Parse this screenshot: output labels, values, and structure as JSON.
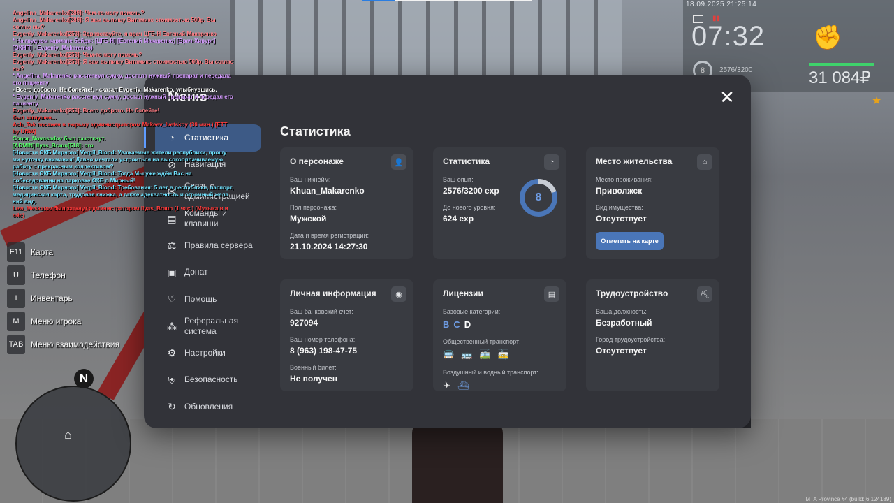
{
  "chat": [
    {
      "text": "Angelina_Makarenko[289]: Чем-то могу помочь?",
      "color": "#ff7b82"
    },
    {
      "text": "Angelina_Makarenko[289]: Я вам выпишу Витамикс стоимостью 500р. Вы соглас ны?",
      "color": "#ff7b82"
    },
    {
      "text": "Evgeniy_Makarenko[253]: Здравствуйте, я врач ЦГБ-Н Евгений Макаренко",
      "color": "#ff7b82"
    },
    {
      "text": "* На грудном кармане бейдж: [ЦГБ-Н] [Евгений Макаренко] [Врач-Хирург] [ОКНП] - Evgeniy_Makarenko)",
      "color": "#d59bff"
    },
    {
      "text": "Evgeniy_Makarenko[253]: Чем-то могу помочь?",
      "color": "#ff7b82"
    },
    {
      "text": "Evgeniy_Makarenko[253]: Я вам выпишу Витамикс стоимостью 500р. Вы соглас ны?",
      "color": "#ff7b82"
    },
    {
      "text": "* Angelina_Makarenko расстегнул сумку, достала нужный препарат и передала его пациенту",
      "color": "#d59bff"
    },
    {
      "text": "- Всего доброго. Не болейте!, - сказал Evgeniy_Makarenko, улыбнувшись.",
      "color": "#ffffff"
    },
    {
      "text": "* Evgeniy_Makarenko расстегнул сумку, достал нужный препарат и передал его пациенту",
      "color": "#d59bff"
    },
    {
      "text": "Evgeniy_Makarenko[253]: Всего доброго. Не болейте!",
      "color": "#ff7b82"
    },
    {
      "text": "был заглушен...",
      "color": "#ff3b3b"
    },
    {
      "text": "Ach_Tok посажен в тюрьму администратором Makeev_Ivetskoy (30 мин.) [ETT by UNW]",
      "color": "#ff3b3b"
    },
    {
      "text": "Conor_Novosadov был разоткнут.",
      "color": "#56ff6a"
    },
    {
      "text": "[ADMIN] Ilyas_Braun[518]: ого",
      "color": "#56ff6a"
    },
    {
      "text": "[Новости ОКБ Мирного] Vergil_Blood: Уважаемые жители республики, прошу ми нуточку внимания! Давно мечтали устроиться на высокооплачиваемую работу с прекрасным коллективом?",
      "color": "#6fe3ff"
    },
    {
      "text": "[Новости ОКБ Мирного] Vergil_Blood: Тогда Мы уже ждём Вас на собеседовании на парковке ОКБ г. Мирный!",
      "color": "#6fe3ff"
    },
    {
      "text": "[Новости ОКБ Мирного] Vergil_Blood: Требования: 5 лет в республике, паспорт, медицинская карта, трудовая книжка, а также адекватность и огромный жела ний вид.",
      "color": "#6fe3ff"
    },
    {
      "text": "Lew_Meskatov был заткнут администратором Ilyas_Braun (1 час.) (Музыка в и ойс)",
      "color": "#ff3b3b"
    }
  ],
  "hud": {
    "datetime": "18.09.2025 21:25:14",
    "time": "07:32",
    "level": "8",
    "exp": "2576/3200",
    "money": "31 084₽"
  },
  "hotkeys": [
    {
      "key": "F11",
      "label": "Карта"
    },
    {
      "key": "U",
      "label": "Телефон"
    },
    {
      "key": "I",
      "label": "Инвентарь"
    },
    {
      "key": "M",
      "label": "Меню игрока"
    },
    {
      "key": "TAB",
      "label": "Меню взаимодействия"
    }
  ],
  "radar": {
    "north": "N"
  },
  "status_line": "MTA Province #4 (build: 6.124189)",
  "menu": {
    "title": "Меню",
    "close": "✕",
    "nav": [
      {
        "label": "Статистика",
        "icon": "pie-icon",
        "active": true
      },
      {
        "label": "Навигация",
        "icon": "compass-icon"
      },
      {
        "label": "Связь с администрацией",
        "icon": "chat-icon"
      },
      {
        "label": "Команды и клавиши",
        "icon": "document-icon"
      },
      {
        "label": "Правила сервера",
        "icon": "scales-icon"
      },
      {
        "label": "Донат",
        "icon": "wallet-icon"
      },
      {
        "label": "Помощь",
        "icon": "heart-hand-icon"
      },
      {
        "label": "Реферальная система",
        "icon": "network-icon"
      },
      {
        "label": "Настройки",
        "icon": "gear-icon"
      },
      {
        "label": "Безопасность",
        "icon": "shield-icon"
      },
      {
        "label": "Обновления",
        "icon": "refresh-icon"
      }
    ]
  },
  "stats": {
    "title": "Статистика",
    "character": {
      "title": "О персонаже",
      "nick_label": "Ваш никнейм:",
      "nick": "Khuan_Makarenko",
      "gender_label": "Пол персонажа:",
      "gender": "Мужской",
      "reg_label": "Дата и время регистрации:",
      "reg": "21.10.2024 14:27:30"
    },
    "statistics": {
      "title": "Статистика",
      "exp_label": "Ваш опыт:",
      "exp": "2576/3200 exp",
      "next_label": "До нового уровня:",
      "next": "624 exp",
      "level": "8",
      "progress": 0.805
    },
    "residence": {
      "title": "Место жительства",
      "place_label": "Место проживания:",
      "place": "Приволжск",
      "property_label": "Вид имущества:",
      "property": "Отсутствует",
      "map_button": "Отметить на карте"
    },
    "personal": {
      "title": "Личная информация",
      "bank_label": "Ваш банковский счет:",
      "bank": "927094",
      "phone_label": "Ваш номер телефона:",
      "phone": "8 (963) 198-47-75",
      "military_label": "Военный билет:",
      "military": "Не получен"
    },
    "licenses": {
      "title": "Лицензии",
      "base_label": "Базовые категории:",
      "categories": [
        {
          "c": "B",
          "color": "#6f9de5"
        },
        {
          "c": "C",
          "color": "#6f9de5"
        },
        {
          "c": "D",
          "color": "#ffffff"
        }
      ],
      "public_label": "Общественный транспорт:",
      "air_label": "Воздушный и водный транспорт:"
    },
    "employment": {
      "title": "Трудоустройство",
      "position_label": "Ваша должность:",
      "position": "Безработный",
      "city_label": "Город трудоустройства:",
      "city": "Отсутствует"
    }
  }
}
